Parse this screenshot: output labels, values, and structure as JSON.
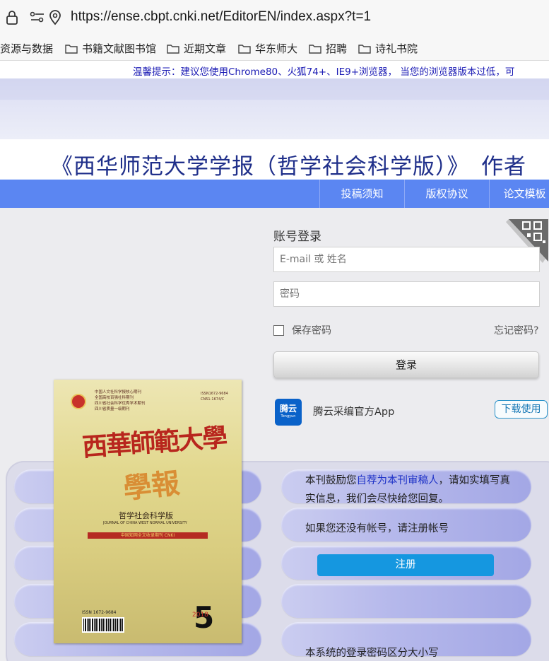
{
  "browser": {
    "url": "https://ense.cbpt.cnki.net/EditorEN/index.aspx?t=1",
    "icons": [
      "lock-icon",
      "permissions-icon",
      "location-icon"
    ]
  },
  "bookmarks": [
    "资源与数据",
    "书籍文献图书馆",
    "近期文章",
    "华东师大",
    "招聘",
    "诗礼书院"
  ],
  "notice": "温馨提示：建议您使用Chrome80、火狐74+、IE9+浏览器， 当您的浏览器版本过低，可",
  "site_title": "《西华师范大学学报（哲学社会科学版）》　作者",
  "nav": [
    "投稿须知",
    "版权协议",
    "论文模板"
  ],
  "login": {
    "title": "账号登录",
    "username_placeholder": "E-mail 或 姓名",
    "password_placeholder": "密码",
    "remember_label": "保存密码",
    "forgot_label": "忘记密码?",
    "submit_label": "登录"
  },
  "app": {
    "logo_text": "腾云",
    "logo_sub": "Tengyun",
    "name": "腾云采编官方App",
    "download_label": "下载使用"
  },
  "info": {
    "line1_prefix": "本刊鼓励您",
    "line1_link": "自荐为本刊审稿人",
    "line1_suffix": "，请如实填写真实信息，我们会尽快给您回复。",
    "register_hint": "如果您还没有帐号，请注册帐号",
    "register_label": "注册",
    "case_hint": "本系统的登录密码区分大小写"
  },
  "cover": {
    "header_lines": [
      "中国人文社科学报核心期刊",
      "全国高校百强社科期刊",
      "四川省社会科学优秀学术期刊",
      "四川省质量一级期刊"
    ],
    "issn_top": [
      "ISSN1672-9684",
      "CN51-1674/C"
    ],
    "brand": "西華師範大學",
    "brand2": "學報",
    "subtitle": "哲学社会科学版",
    "subtitle_en": "JOURNAL OF CHINA WEST NORMAL UNIVERSITY",
    "band_text": "中国知网全文收录期刊 CNKI",
    "issn": "ISSN 1672-9684",
    "issue": "5",
    "year": "2018"
  }
}
